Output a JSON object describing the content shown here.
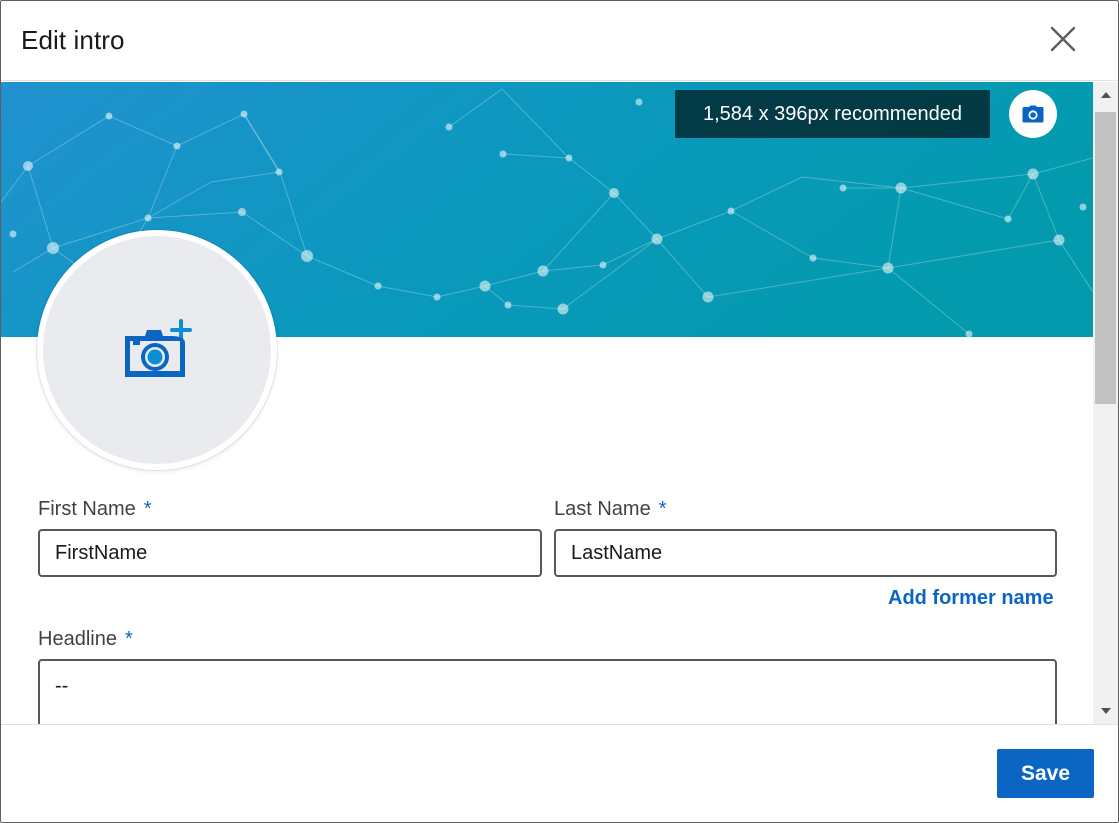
{
  "header": {
    "title": "Edit intro",
    "close_icon": "close-icon"
  },
  "banner": {
    "dimension_hint": "1,584 x 396px recommended",
    "camera_icon": "camera-icon",
    "colors": {
      "left": "#1f8ecc",
      "right": "#039aae"
    }
  },
  "avatar": {
    "icon": "camera-add-icon",
    "background": "#e9ebee"
  },
  "form": {
    "first_name": {
      "label": "First Name",
      "required_mark": "*",
      "value": "FirstName"
    },
    "last_name": {
      "label": "Last Name",
      "required_mark": "*",
      "value": "LastName"
    },
    "add_former_name": "Add former name",
    "headline": {
      "label": "Headline",
      "required_mark": "*",
      "value": "--"
    }
  },
  "footer": {
    "save_label": "Save"
  },
  "colors": {
    "accent": "#0a66c2",
    "input_border": "#585858",
    "required": "#0a66c2"
  }
}
